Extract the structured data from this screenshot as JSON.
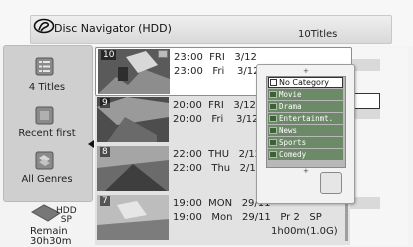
{
  "header": {
    "title": "Disc Navigator (HDD)",
    "count": "10Titles"
  },
  "sidebar": {
    "items": [
      {
        "label": "4 Titles",
        "icon": "list-icon"
      },
      {
        "label": "Recent first",
        "icon": "sort-icon"
      },
      {
        "label": "All Genres",
        "icon": "genre-icon"
      }
    ]
  },
  "footer": {
    "media_line1": "HDD",
    "media_line2": "SP",
    "remain_label": "Remain",
    "remain_time": "30h30m"
  },
  "titles": [
    {
      "num": "10",
      "line1": "23:00  FRI   3/12",
      "line2": "23:00   Fri    3/12"
    },
    {
      "num": "9",
      "line1": "20:00  FRI   3/12",
      "line2": "20:00   Fri    3/12"
    },
    {
      "num": "8",
      "line1": "22:00  THU   2/12",
      "line2": "22:00   Thu   2/12"
    },
    {
      "num": "7",
      "line1": "19:00  MON   29/11",
      "line2": "19:00   Mon   29/11   Pr 2   SP",
      "line3": "1h00m(1.0G)"
    }
  ],
  "genre_popup": {
    "selected": "No Category",
    "options": [
      "Movie",
      "Drama",
      "Entertainmt.",
      "News",
      "Sports",
      "Comedy"
    ]
  }
}
